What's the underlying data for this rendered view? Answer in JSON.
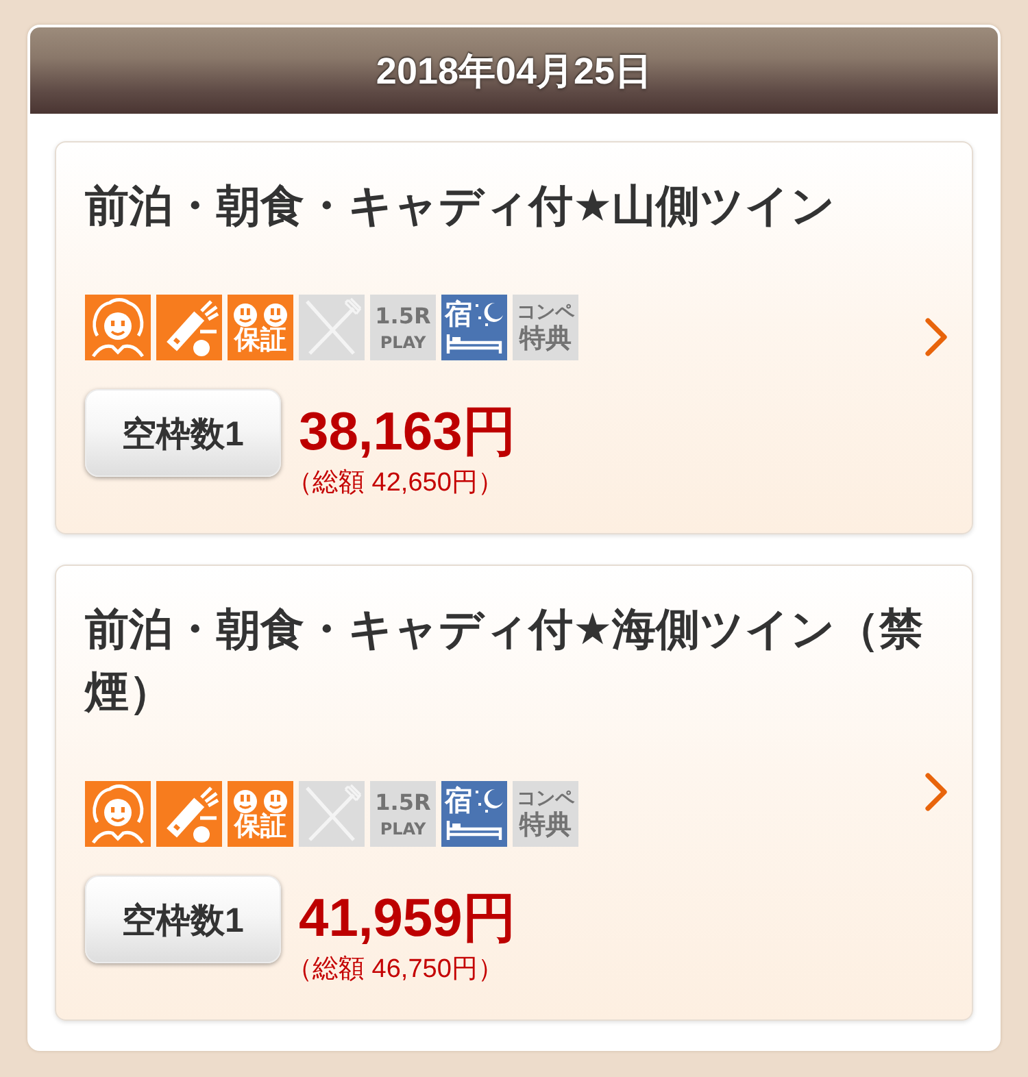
{
  "header": {
    "date": "2018年04月25日"
  },
  "plans": [
    {
      "title": "前泊・朝食・キャディ付★山側ツイン",
      "features": [
        {
          "kind": "caddie",
          "on": true
        },
        {
          "kind": "cart",
          "on": true
        },
        {
          "kind": "guarantee",
          "on": true,
          "label": "保証"
        },
        {
          "kind": "meal",
          "on": false
        },
        {
          "kind": "play",
          "on": false,
          "label": "1.5R",
          "sublabel": "PLAY"
        },
        {
          "kind": "stay",
          "on": true,
          "label": "宿"
        },
        {
          "kind": "compe",
          "on": false,
          "label": "コンペ",
          "sublabel": "特典"
        }
      ],
      "vacancy": "空枠数1",
      "price": "38,163円",
      "total": "（総額 42,650円）"
    },
    {
      "title": "前泊・朝食・キャディ付★海側ツイン（禁煙）",
      "features": [
        {
          "kind": "caddie",
          "on": true
        },
        {
          "kind": "cart",
          "on": true
        },
        {
          "kind": "guarantee",
          "on": true,
          "label": "保証"
        },
        {
          "kind": "meal",
          "on": false
        },
        {
          "kind": "play",
          "on": false,
          "label": "1.5R",
          "sublabel": "PLAY"
        },
        {
          "kind": "stay",
          "on": true,
          "label": "宿"
        },
        {
          "kind": "compe",
          "on": false,
          "label": "コンペ",
          "sublabel": "特典"
        }
      ],
      "vacancy": "空枠数1",
      "price": "41,959円",
      "total": "（総額 46,750円）"
    }
  ]
}
